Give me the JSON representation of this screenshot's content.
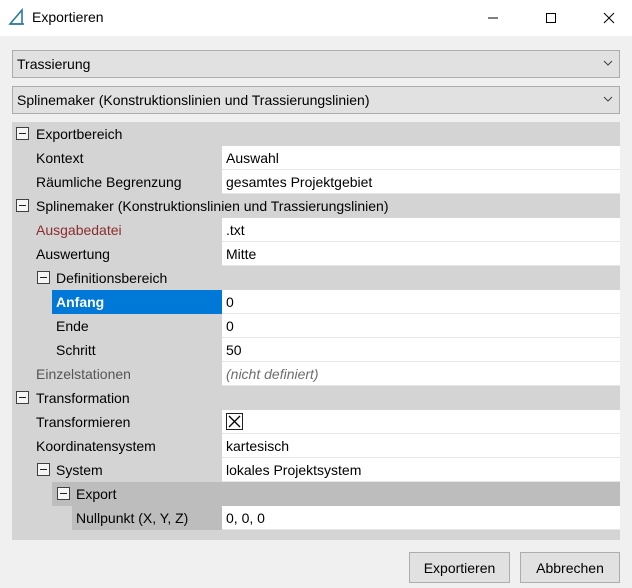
{
  "window": {
    "title": "Exportieren",
    "accent": "#0078d7"
  },
  "combos": {
    "format": "Trassierung",
    "exporter": "Splinemaker (Konstruktionslinien und Trassierungslinien)"
  },
  "grid": {
    "exportbereich": {
      "label": "Exportbereich",
      "kontext_label": "Kontext",
      "kontext_value": "Auswahl",
      "begrenzung_label": "Räumliche Begrenzung",
      "begrenzung_value": "gesamtes Projektgebiet"
    },
    "splinemaker": {
      "label": "Splinemaker (Konstruktionslinien und Trassierungslinien)",
      "ausgabedatei_label": "Ausgabedatei",
      "ausgabedatei_value": ".txt",
      "auswertung_label": "Auswertung",
      "auswertung_value": "Mitte",
      "definitionsbereich_label": "Definitionsbereich",
      "anfang_label": "Anfang",
      "anfang_value": "0",
      "ende_label": "Ende",
      "ende_value": "0",
      "schritt_label": "Schritt",
      "schritt_value": "50",
      "einzelstationen_label": "Einzelstationen",
      "einzelstationen_value": "(nicht definiert)"
    },
    "transformation": {
      "label": "Transformation",
      "transformieren_label": "Transformieren",
      "transformieren_checked": true,
      "koordinatensystem_label": "Koordinatensystem",
      "koordinatensystem_value": "kartesisch",
      "system_label": "System",
      "system_value": "lokales Projektsystem",
      "export_label": "Export",
      "nullpunkt_label": "Nullpunkt (X, Y, Z)",
      "nullpunkt_value": "0, 0, 0"
    }
  },
  "buttons": {
    "export": "Exportieren",
    "cancel": "Abbrechen"
  }
}
